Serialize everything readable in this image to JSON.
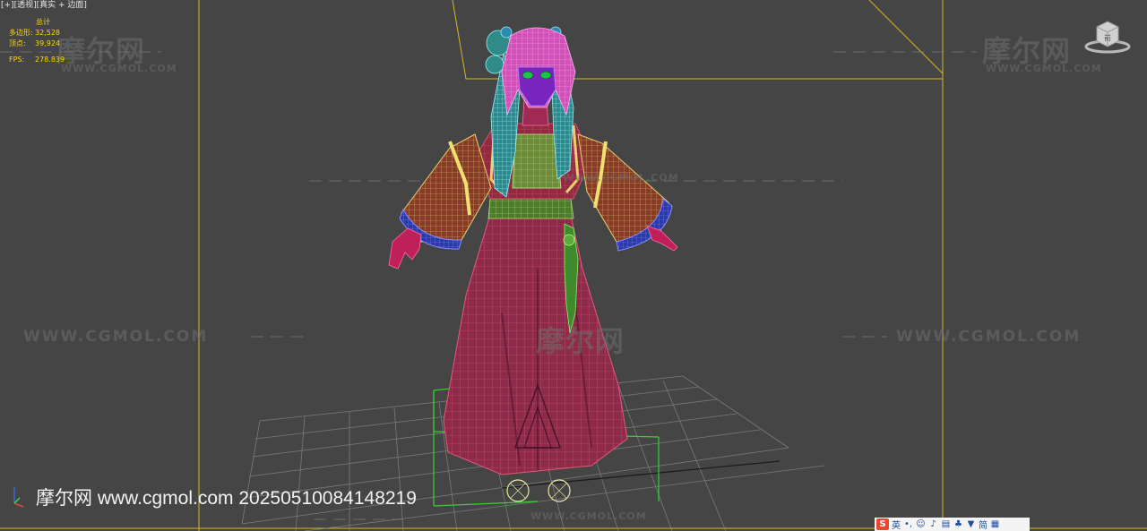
{
  "viewport": {
    "label_prefix": "[+]",
    "label_view": "[透视]",
    "label_shading": "[真实 + 边面]"
  },
  "stats": {
    "header": "总计",
    "polys_label": "多边形:",
    "polys_value": "32,528",
    "verts_label": "顶点:",
    "verts_value": "39,924",
    "fps_label": "FPS:",
    "fps_value": "278.839"
  },
  "watermark": {
    "brand": "摩尔网",
    "url": "WWW.CGMOL.COM"
  },
  "stamp": "摩尔网 www.cgmol.com 20250510084148219",
  "viewcube_label": "前",
  "ime": {
    "logo": "S",
    "mode": "英",
    "icons": [
      "punctuation-icon",
      "emoji-icon",
      "microphone-icon",
      "keyboard-icon",
      "toolbox-icon",
      "skin-icon",
      "simplified-icon",
      "grid-icon"
    ],
    "simplified": "简"
  },
  "colors": {
    "viewport_bg": "#454545",
    "safe_frame": "#d4b626",
    "stats_text": "#ffd800",
    "selection_box": "#35d42c",
    "skirt_wire": "#d03a6a",
    "hair_wire": "#ff55cc"
  }
}
